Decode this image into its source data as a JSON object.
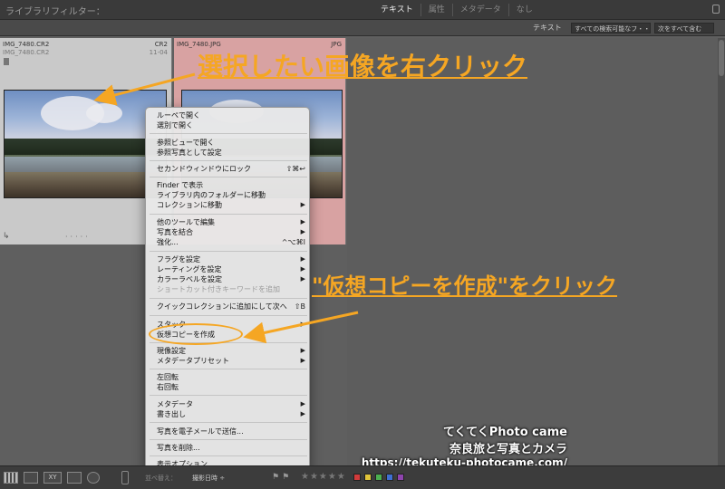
{
  "filterbar": {
    "title": "ライブラリフィルター：",
    "tabs": [
      "テキスト",
      "属性",
      "メタデータ",
      "なし"
    ]
  },
  "searchbar": {
    "label": "テキスト",
    "field_select": "すべての検索可能なフ・・",
    "rule_select": "次をすべて含む"
  },
  "cells": [
    {
      "filename": "IMG_7480.CR2",
      "subname": "IMG_7480.CR2",
      "ext": "CR2",
      "subext": "11-04"
    },
    {
      "filename": "IMG_7480.JPG",
      "subname": "",
      "ext": "JPG",
      "subext": ""
    }
  ],
  "menu": {
    "items": [
      {
        "label": "ルーペで開く"
      },
      {
        "label": "選別で開く"
      },
      {
        "label": "参照ビューで開く"
      },
      {
        "label": "参照写真として設定"
      },
      {
        "label": "セカンドウィンドウにロック",
        "shortcut": "⇧⌘↩"
      },
      {
        "label": "Finder で表示"
      },
      {
        "label": "ライブラリ内のフォルダーに移動"
      },
      {
        "label": "コレクションに移動",
        "arrow": "▶"
      },
      {
        "label": "他のツールで編集",
        "arrow": "▶"
      },
      {
        "label": "写真を結合",
        "arrow": "▶"
      },
      {
        "label": "強化...",
        "shortcut": "^⌥⌘I"
      },
      {
        "label": "フラグを設定",
        "arrow": "▶"
      },
      {
        "label": "レーティングを設定",
        "arrow": "▶"
      },
      {
        "label": "カラーラベルを設定",
        "arrow": "▶"
      },
      {
        "label": "ショートカット付きキーワードを追加"
      },
      {
        "label": "クイックコレクションに追加にして次へ",
        "shortcut": "⇧B"
      },
      {
        "label": "スタック",
        "arrow": "▶"
      },
      {
        "label": "仮想コピーを作成"
      },
      {
        "label": "現像設定",
        "arrow": "▶"
      },
      {
        "label": "メタデータプリセット",
        "arrow": "▶"
      },
      {
        "label": "左回転"
      },
      {
        "label": "右回転"
      },
      {
        "label": "メタデータ",
        "arrow": "▶"
      },
      {
        "label": "書き出し",
        "arrow": "▶"
      },
      {
        "label": "写真を電子メールで送信..."
      },
      {
        "label": "写真を削除..."
      },
      {
        "label": "表示オプション..."
      }
    ]
  },
  "annotations": {
    "step1": "選択したい画像を右クリック",
    "step2": "\"仮想コピーを作成\"をクリック",
    "color": "#f5a623"
  },
  "watermark": {
    "line1": "てくてくPhoto came",
    "line2": "奈良旅と写真とカメラ",
    "line3": "https://tekuteku-photocame.com/"
  },
  "toolbar": {
    "compare_label": "XY",
    "sort_label": "並べ替え：",
    "sort_value": "撮影日時 ÷",
    "stars": "★★★★★",
    "color_labels": [
      "#d23b3b",
      "#e0c43a",
      "#4caf50",
      "#3f6fd2",
      "#8e44ad"
    ]
  }
}
